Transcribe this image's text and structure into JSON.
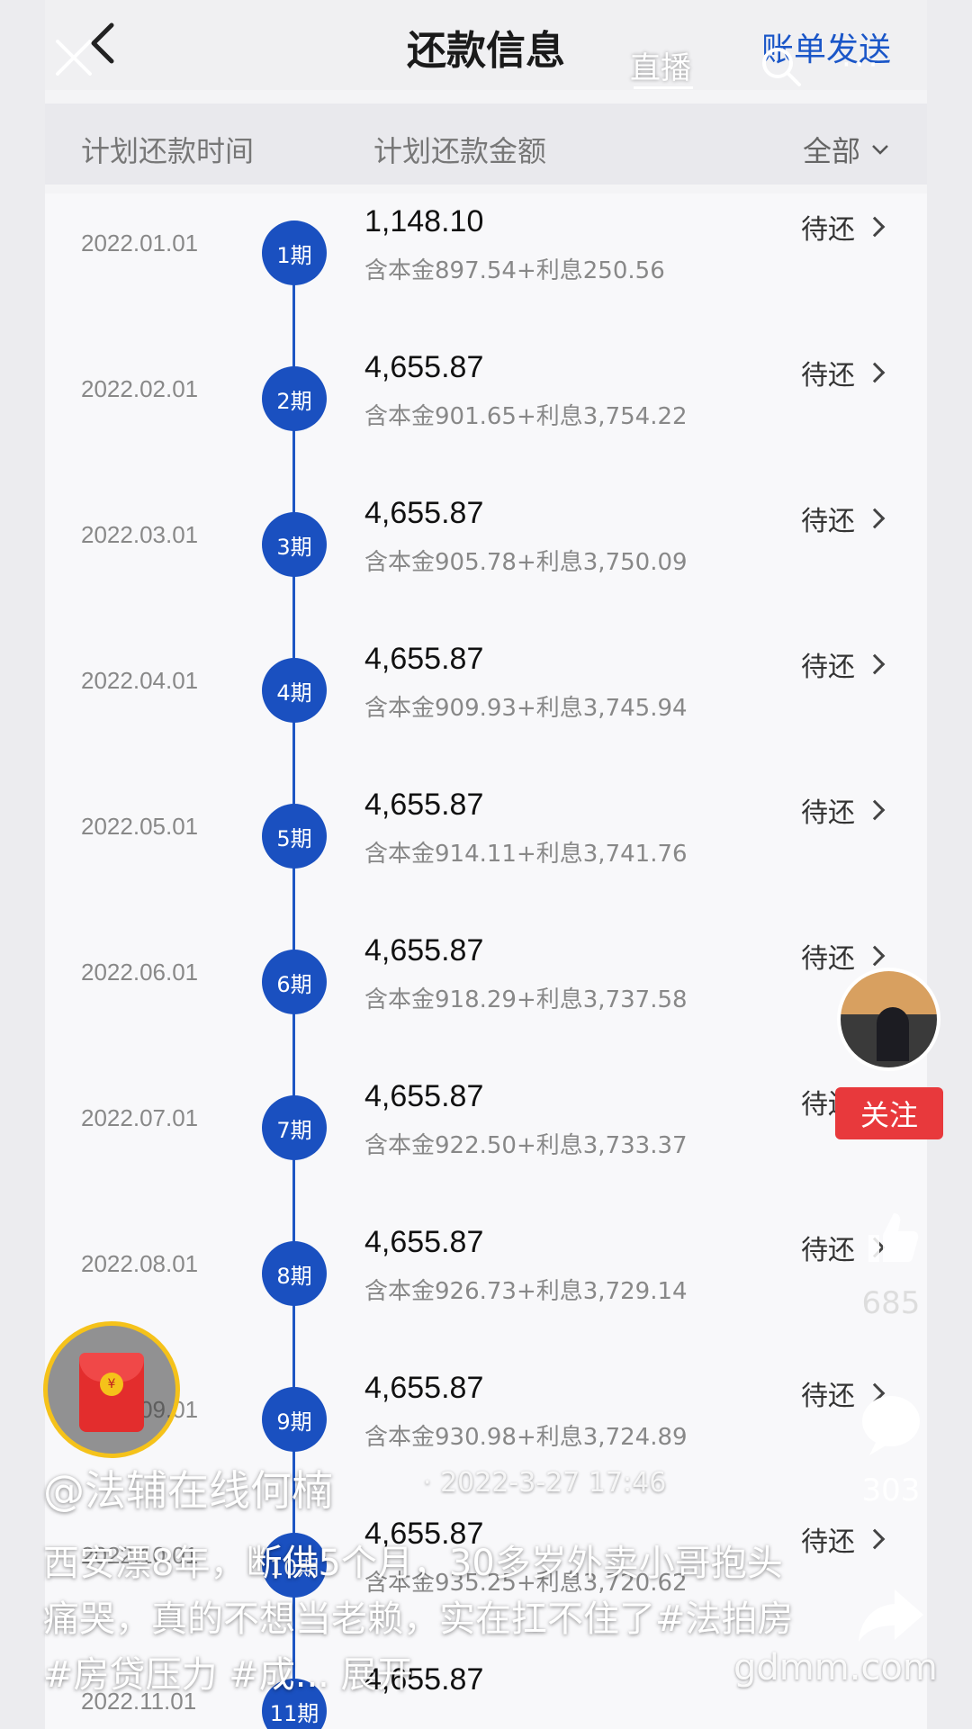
{
  "header": {
    "title": "还款信息",
    "bill_send": "账单发送"
  },
  "filter_bar": {
    "col_date": "计划还款时间",
    "col_amount": "计划还款金额",
    "filter_label": "全部"
  },
  "rows": [
    {
      "date": "2022.01.01",
      "period": "1期",
      "amount": "1,148.10",
      "detail": "含本金897.54+利息250.56",
      "status": "待还"
    },
    {
      "date": "2022.02.01",
      "period": "2期",
      "amount": "4,655.87",
      "detail": "含本金901.65+利息3,754.22",
      "status": "待还"
    },
    {
      "date": "2022.03.01",
      "period": "3期",
      "amount": "4,655.87",
      "detail": "含本金905.78+利息3,750.09",
      "status": "待还"
    },
    {
      "date": "2022.04.01",
      "period": "4期",
      "amount": "4,655.87",
      "detail": "含本金909.93+利息3,745.94",
      "status": "待还"
    },
    {
      "date": "2022.05.01",
      "period": "5期",
      "amount": "4,655.87",
      "detail": "含本金914.11+利息3,741.76",
      "status": "待还"
    },
    {
      "date": "2022.06.01",
      "period": "6期",
      "amount": "4,655.87",
      "detail": "含本金918.29+利息3,737.58",
      "status": "待还"
    },
    {
      "date": "2022.07.01",
      "period": "7期",
      "amount": "4,655.87",
      "detail": "含本金922.50+利息3,733.37",
      "status": "待还"
    },
    {
      "date": "2022.08.01",
      "period": "8期",
      "amount": "4,655.87",
      "detail": "含本金926.73+利息3,729.14",
      "status": "待还"
    },
    {
      "date": "2022.09.01",
      "period": "9期",
      "amount": "4,655.87",
      "detail": "含本金930.98+利息3,724.89",
      "status": "待还"
    },
    {
      "date": "2022.10.01",
      "period": "10期",
      "amount": "4,655.87",
      "detail": "含本金935.25+利息3,720.62",
      "status": "待还"
    },
    {
      "date": "2022.11.01",
      "period": "11期",
      "amount": "4,655.87",
      "detail": "",
      "status": ""
    }
  ],
  "overlay": {
    "live_label": "直播",
    "follow_label": "关注",
    "likes": "685",
    "comments": "303",
    "author": "@法辅在线何楠",
    "timestamp": "· 2022-3-27 17:46",
    "caption": "西安漂8年，断供5个月，30多岁外卖小哥抱头痛哭，真的不想当老赖，实在扛不住了#法拍房 #房贷压力 #成...",
    "expand": "展开",
    "watermark": "gdmm.com",
    "colors": {
      "accent_blue": "#1a50c0",
      "follow_red": "#e8393c",
      "packet_gold": "#f5c21a"
    }
  }
}
